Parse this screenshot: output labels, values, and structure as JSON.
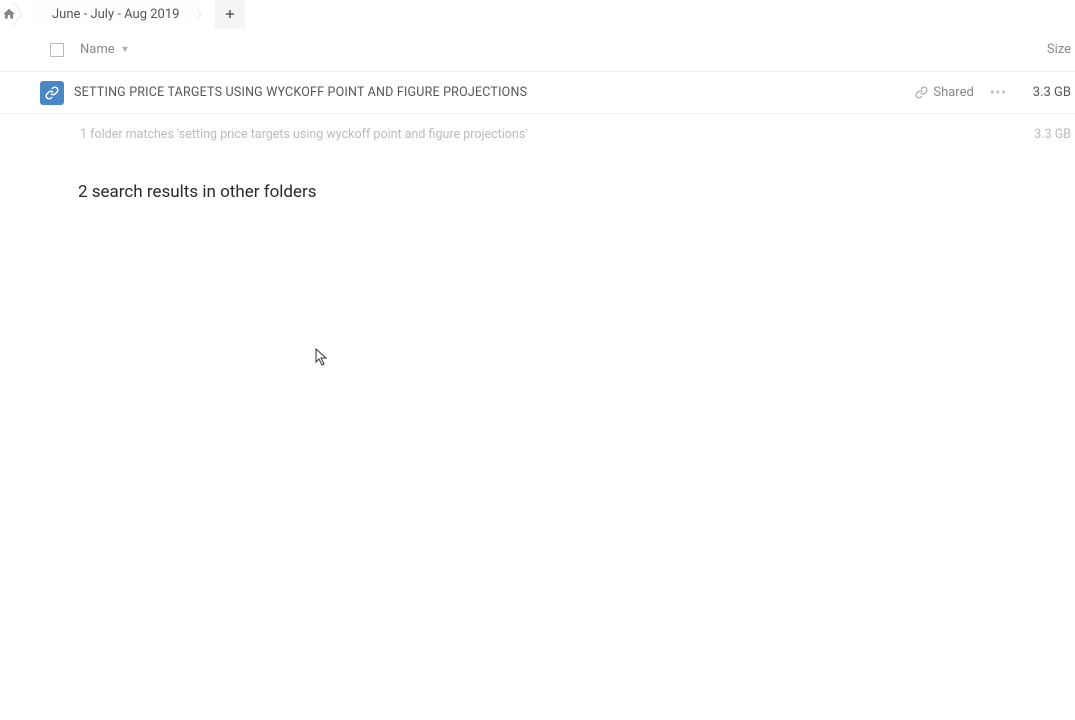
{
  "breadcrumb": {
    "current": "June - July - Aug 2019"
  },
  "columns": {
    "name": "Name",
    "size": "Size"
  },
  "items": [
    {
      "name": "SETTING PRICE TARGETS USING WYCKOFF POINT AND FIGURE PROJECTIONS",
      "shared_label": "Shared",
      "size": "3.3 GB"
    }
  ],
  "summary": {
    "text": "1 folder matches 'setting price targets using wyckoff point and figure projections'",
    "total_size": "3.3 GB"
  },
  "other_results": {
    "heading": "2 search results in other folders"
  }
}
